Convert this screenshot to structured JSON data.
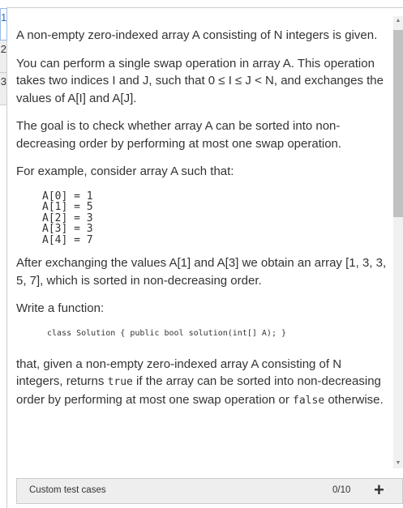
{
  "tabs": [
    {
      "label": "1"
    },
    {
      "label": "2"
    },
    {
      "label": "3"
    }
  ],
  "task": {
    "p1": "A non-empty zero-indexed array A consisting of N integers is given.",
    "p2": "You can perform a single swap operation in array A. This operation takes two indices I and J, such that 0 ≤ I ≤ J < N, and exchanges the values of A[I] and A[J].",
    "p3": "The goal is to check whether array A can be sorted into non-decreasing order by performing at most one swap operation.",
    "p4": "For example, consider array A such that:",
    "array": "A[0] = 1\nA[1] = 5\nA[2] = 3\nA[3] = 3\nA[4] = 7",
    "p5": "After exchanging the values A[1] and A[3] we obtain an array [1, 3, 3, 5, 7], which is sorted in non-decreasing order.",
    "p6": "Write a function:",
    "signature": "class Solution { public bool solution(int[] A); }",
    "p7_a": "that, given a non-empty zero-indexed array A consisting of N integers, returns ",
    "p7_true": "true",
    "p7_b": " if the array can be sorted into non-decreasing order by performing at most one swap operation or ",
    "p7_false": "false",
    "p7_c": " otherwise."
  },
  "footer": {
    "label": "Custom test cases",
    "count": "0/10",
    "add_icon": "plus-icon"
  }
}
